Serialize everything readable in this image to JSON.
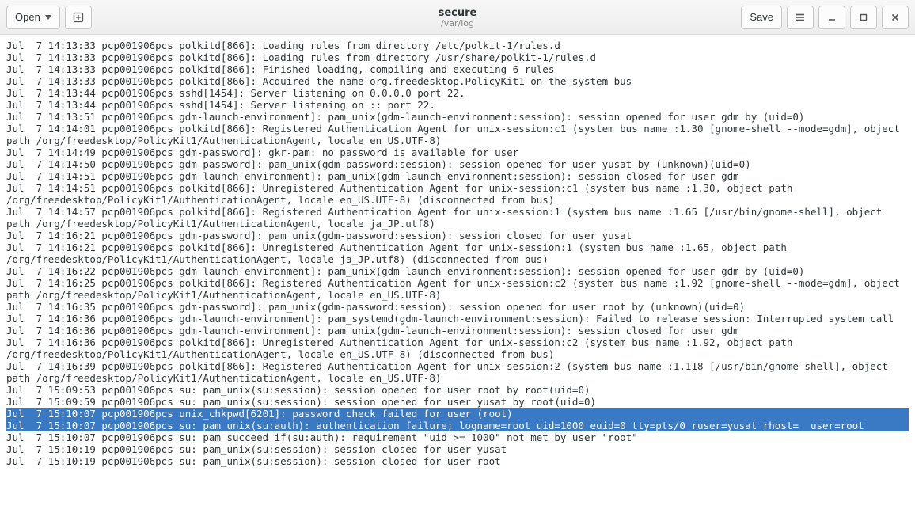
{
  "header": {
    "open_label": "Open",
    "title": "secure",
    "subtitle": "/var/log",
    "save_label": "Save"
  },
  "log": {
    "lines": [
      {
        "sel": false,
        "text": "Jul  7 14:13:33 pcp001906pcs polkitd[866]: Loading rules from directory /etc/polkit-1/rules.d"
      },
      {
        "sel": false,
        "text": "Jul  7 14:13:33 pcp001906pcs polkitd[866]: Loading rules from directory /usr/share/polkit-1/rules.d"
      },
      {
        "sel": false,
        "text": "Jul  7 14:13:33 pcp001906pcs polkitd[866]: Finished loading, compiling and executing 6 rules"
      },
      {
        "sel": false,
        "text": "Jul  7 14:13:33 pcp001906pcs polkitd[866]: Acquired the name org.freedesktop.PolicyKit1 on the system bus"
      },
      {
        "sel": false,
        "text": "Jul  7 14:13:44 pcp001906pcs sshd[1454]: Server listening on 0.0.0.0 port 22."
      },
      {
        "sel": false,
        "text": "Jul  7 14:13:44 pcp001906pcs sshd[1454]: Server listening on :: port 22."
      },
      {
        "sel": false,
        "text": "Jul  7 14:13:51 pcp001906pcs gdm-launch-environment]: pam_unix(gdm-launch-environment:session): session opened for user gdm by (uid=0)"
      },
      {
        "sel": false,
        "text": "Jul  7 14:14:01 pcp001906pcs polkitd[866]: Registered Authentication Agent for unix-session:c1 (system bus name :1.30 [gnome-shell --mode=gdm], object path /org/freedesktop/PolicyKit1/AuthenticationAgent, locale en_US.UTF-8)"
      },
      {
        "sel": false,
        "text": "Jul  7 14:14:49 pcp001906pcs gdm-password]: gkr-pam: no password is available for user"
      },
      {
        "sel": false,
        "text": "Jul  7 14:14:50 pcp001906pcs gdm-password]: pam_unix(gdm-password:session): session opened for user yusat by (unknown)(uid=0)"
      },
      {
        "sel": false,
        "text": "Jul  7 14:14:51 pcp001906pcs gdm-launch-environment]: pam_unix(gdm-launch-environment:session): session closed for user gdm"
      },
      {
        "sel": false,
        "text": "Jul  7 14:14:51 pcp001906pcs polkitd[866]: Unregistered Authentication Agent for unix-session:c1 (system bus name :1.30, object path /org/freedesktop/PolicyKit1/AuthenticationAgent, locale en_US.UTF-8) (disconnected from bus)"
      },
      {
        "sel": false,
        "text": "Jul  7 14:14:57 pcp001906pcs polkitd[866]: Registered Authentication Agent for unix-session:1 (system bus name :1.65 [/usr/bin/gnome-shell], object path /org/freedesktop/PolicyKit1/AuthenticationAgent, locale ja_JP.utf8)"
      },
      {
        "sel": false,
        "text": "Jul  7 14:16:21 pcp001906pcs gdm-password]: pam_unix(gdm-password:session): session closed for user yusat"
      },
      {
        "sel": false,
        "text": "Jul  7 14:16:21 pcp001906pcs polkitd[866]: Unregistered Authentication Agent for unix-session:1 (system bus name :1.65, object path /org/freedesktop/PolicyKit1/AuthenticationAgent, locale ja_JP.utf8) (disconnected from bus)"
      },
      {
        "sel": false,
        "text": "Jul  7 14:16:22 pcp001906pcs gdm-launch-environment]: pam_unix(gdm-launch-environment:session): session opened for user gdm by (uid=0)"
      },
      {
        "sel": false,
        "text": "Jul  7 14:16:25 pcp001906pcs polkitd[866]: Registered Authentication Agent for unix-session:c2 (system bus name :1.92 [gnome-shell --mode=gdm], object path /org/freedesktop/PolicyKit1/AuthenticationAgent, locale en_US.UTF-8)"
      },
      {
        "sel": false,
        "text": "Jul  7 14:16:35 pcp001906pcs gdm-password]: pam_unix(gdm-password:session): session opened for user root by (unknown)(uid=0)"
      },
      {
        "sel": false,
        "text": "Jul  7 14:16:36 pcp001906pcs gdm-launch-environment]: pam_systemd(gdm-launch-environment:session): Failed to release session: Interrupted system call"
      },
      {
        "sel": false,
        "text": "Jul  7 14:16:36 pcp001906pcs gdm-launch-environment]: pam_unix(gdm-launch-environment:session): session closed for user gdm"
      },
      {
        "sel": false,
        "text": "Jul  7 14:16:36 pcp001906pcs polkitd[866]: Unregistered Authentication Agent for unix-session:c2 (system bus name :1.92, object path /org/freedesktop/PolicyKit1/AuthenticationAgent, locale en_US.UTF-8) (disconnected from bus)"
      },
      {
        "sel": false,
        "text": "Jul  7 14:16:39 pcp001906pcs polkitd[866]: Registered Authentication Agent for unix-session:2 (system bus name :1.118 [/usr/bin/gnome-shell], object path /org/freedesktop/PolicyKit1/AuthenticationAgent, locale en_US.UTF-8)"
      },
      {
        "sel": false,
        "text": "Jul  7 15:09:53 pcp001906pcs su: pam_unix(su:session): session opened for user root by root(uid=0)"
      },
      {
        "sel": false,
        "text": "Jul  7 15:09:59 pcp001906pcs su: pam_unix(su:session): session opened for user yusat by root(uid=0)"
      },
      {
        "sel": true,
        "text": "Jul  7 15:10:07 pcp001906pcs unix_chkpwd[6201]: password check failed for user (root)"
      },
      {
        "sel": true,
        "text": "Jul  7 15:10:07 pcp001906pcs su: pam_unix(su:auth): authentication failure; logname=root uid=1000 euid=0 tty=pts/0 ruser=yusat rhost=  user=root"
      },
      {
        "sel": false,
        "text": "Jul  7 15:10:07 pcp001906pcs su: pam_succeed_if(su:auth): requirement \"uid >= 1000\" not met by user \"root\""
      },
      {
        "sel": false,
        "text": "Jul  7 15:10:19 pcp001906pcs su: pam_unix(su:session): session closed for user yusat"
      },
      {
        "sel": false,
        "text": "Jul  7 15:10:19 pcp001906pcs su: pam_unix(su:session): session closed for user root"
      }
    ]
  }
}
